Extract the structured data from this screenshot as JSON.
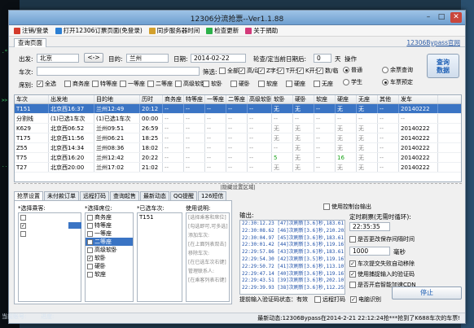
{
  "window": {
    "title": "12306分流抢票--Ver1.1.88"
  },
  "menu": [
    {
      "label": "注销/登录",
      "icon": "logout-icon",
      "color": "#d33a2c"
    },
    {
      "label": "打开12306订票页面(免登录)",
      "icon": "globe-icon",
      "color": "#2c7fd3"
    },
    {
      "label": "同步服务器时间",
      "icon": "sync-icon",
      "color": "#d3a02c"
    },
    {
      "label": "检查更新",
      "icon": "check-icon",
      "color": "#2cb14a"
    },
    {
      "label": "关于捐助",
      "icon": "heart-icon",
      "color": "#d33a7a"
    }
  ],
  "tabs": {
    "query": "查询页面",
    "bypass_link": "12306Bypass官网"
  },
  "form": {
    "from_label": "出发:",
    "from_value": "北京",
    "swap": "<->",
    "to_label": "目的:",
    "to_value": "兰州",
    "date_label": "日期:",
    "date_value": "2014-02-22",
    "interval_label": "轮查/定当前日期后:",
    "interval_value": "0",
    "interval_unit": "天",
    "operate_label": "操作",
    "train_label": "车次:",
    "filter_label": "筛选:",
    "train_types": [
      {
        "label": "全部",
        "checked": false
      },
      {
        "label": "高/动",
        "checked": true
      },
      {
        "label": "Z字头",
        "checked": true
      },
      {
        "label": "T开头",
        "checked": true
      },
      {
        "label": "K开头",
        "checked": true
      },
      {
        "label": "数/临",
        "checked": true
      }
    ],
    "seat_label": "席别:",
    "seats": [
      {
        "label": "全选",
        "checked": true
      },
      {
        "label": "商务座",
        "checked": false
      },
      {
        "label": "特等座",
        "checked": false
      },
      {
        "label": "一等座",
        "checked": false
      },
      {
        "label": "二等座",
        "checked": false
      },
      {
        "label": "高级软卧",
        "checked": false
      },
      {
        "label": "软卧",
        "checked": false
      },
      {
        "label": "硬卧",
        "checked": false
      },
      {
        "label": "软座",
        "checked": false
      },
      {
        "label": "硬座",
        "checked": false
      },
      {
        "label": "无座",
        "checked": false
      }
    ],
    "ticket_type": [
      {
        "label": "普通",
        "checked": true
      },
      {
        "label": "学生",
        "checked": false
      }
    ],
    "mode": [
      {
        "label": "余票查询",
        "checked": false
      },
      {
        "label": "车票预定",
        "checked": true
      }
    ],
    "query_button": "查询\n数据"
  },
  "table": {
    "headers": [
      "车次",
      "出发地",
      "目的地",
      "历时",
      "商务座",
      "特等座",
      "一等座",
      "二等座",
      "高级软卧",
      "软卧",
      "硬卧",
      "软座",
      "硬座",
      "无座",
      "其他",
      "发车"
    ],
    "rows": [
      {
        "sel": true,
        "cells": [
          "T151",
          "北京西16:37",
          "兰州12:49",
          "20:12",
          "--",
          "--",
          "--",
          "--",
          "--",
          "无",
          "无",
          "--",
          "无",
          "无",
          "--",
          "20140222"
        ]
      },
      {
        "sel": false,
        "cells": [
          "分割线",
          "(1)已选1车次",
          "(1)已选1车次",
          "00:00",
          "--",
          "--",
          "--",
          "--",
          "--",
          "--",
          "--",
          "--",
          "--",
          "--",
          "--",
          "--"
        ]
      },
      {
        "sel": false,
        "cells": [
          "K629",
          "北京西06:52",
          "兰州09:51",
          "26:59",
          "--",
          "--",
          "--",
          "--",
          "--",
          "无",
          "无",
          "--",
          "无",
          "无",
          "--",
          "20140222"
        ]
      },
      {
        "sel": false,
        "cells": [
          "T175",
          "北京西11:56",
          "兰州06:21",
          "18:25",
          "--",
          "--",
          "--",
          "--",
          "--",
          "无",
          "无",
          "--",
          "无",
          "无",
          "--",
          "20140222"
        ]
      },
      {
        "sel": false,
        "cells": [
          "Z55",
          "北京西14:34",
          "兰州08:36",
          "18:02",
          "--",
          "--",
          "--",
          "--",
          "--",
          "--",
          "无",
          "--",
          "无",
          "无",
          "--",
          "20140222"
        ]
      },
      {
        "sel": false,
        "cells": [
          "T75",
          "北京西16:20",
          "兰州12:42",
          "20:22",
          "--",
          "--",
          "--",
          "--",
          "--",
          "5",
          "无",
          "--",
          "16",
          "无",
          "--",
          "20140222"
        ]
      },
      {
        "sel": false,
        "cells": [
          "T27",
          "北京西20:00",
          "兰州17:02",
          "21:02",
          "--",
          "--",
          "--",
          "--",
          "--",
          "无",
          "无",
          "--",
          "无",
          "无",
          "--",
          "20140222"
        ]
      }
    ]
  },
  "splitter": "|隐藏设置区域|",
  "bottom_tabs": [
    "抢票设置",
    "未付款订单",
    "远程打码",
    "查询起售",
    "最新动态",
    "QQ提醒",
    "126短信"
  ],
  "settings": {
    "passenger_label": "*选择乘客:",
    "seat_label": "*选择席位:",
    "selected_trains_label": "*已选车次:",
    "selected_train": "T151",
    "usage_label": "使用说明:",
    "usage_lines": [
      "[选择乘客和席位]",
      "[勾选即可,可多选]",
      "添加车次:",
      "[在上面列表双击]",
      "移除车次:",
      "[在已选车次右键]",
      "管理联系人:",
      "[在乘客列表右键]"
    ],
    "seat_list": [
      {
        "label": "商务座",
        "checked": false,
        "hl": false
      },
      {
        "label": "特等座",
        "checked": false,
        "hl": false
      },
      {
        "label": "一等座",
        "checked": false,
        "hl": false
      },
      {
        "label": "二等座",
        "checked": false,
        "hl": true
      },
      {
        "label": "高级软卧",
        "checked": false,
        "hl": false
      },
      {
        "label": "软卧",
        "checked": true,
        "hl": false
      },
      {
        "label": "硬卧",
        "checked": false,
        "hl": false
      },
      {
        "label": "软座",
        "checked": false,
        "hl": false
      }
    ]
  },
  "output": {
    "label": "输出:",
    "lines": [
      "22:30:12.23 [47]次刷新[3.6]秒,183.61.133.15",
      "22:30:08.62 [46]次刷新[3.6]秒,210.202.111.35",
      "22:30:04.97 [45]次刷新[3.6]秒,183.61.133.14",
      "22:30:01.42 [44]次刷新[3.6]秒,119.167.77.30",
      "22:29:57.86 [43]次刷新[3.6]秒,183.61.133.14",
      "22:29:54.30 [42]次刷新[3.5]秒,119.167.77.30",
      "22:29:50.72 [41]次刷新[3.6]秒,113.107.56.83",
      "22:29:47.14 [40]次刷新[3.6]秒,119.167.77.30",
      "22:29:43.51 [39]次刷新[3.6]秒,202.107.244.73",
      "22:29:39.93 [38]次刷新[3.6]秒,112.255.19.173"
    ],
    "custom_output": "使用控制台输出"
  },
  "right": {
    "timer_label": "定时刷票(无需时循环):",
    "timer_value": "22:35:35",
    "skip_label": "是否更改保存间隔时间",
    "refresh_value": "1000",
    "refresh_unit": "毫秒",
    "options": [
      {
        "label": "车次提交失败自动移除",
        "checked": true
      },
      {
        "label": "使用捕捉输入的验证码",
        "checked": true
      },
      {
        "label": "是否开启智能加速CDN",
        "checked": false
      }
    ],
    "stop_button": "停止"
  },
  "captcha": {
    "label": "提前输入验证码状态：有效",
    "remote": "远程打码",
    "auto": "电脑识别"
  },
  "status": {
    "account_label": "当前账号:",
    "progress_label": "进度:",
    "message": "最新动态:12306Bypass在2014-2-21 22:12:24抢***抢到了K688车次的车票!"
  }
}
